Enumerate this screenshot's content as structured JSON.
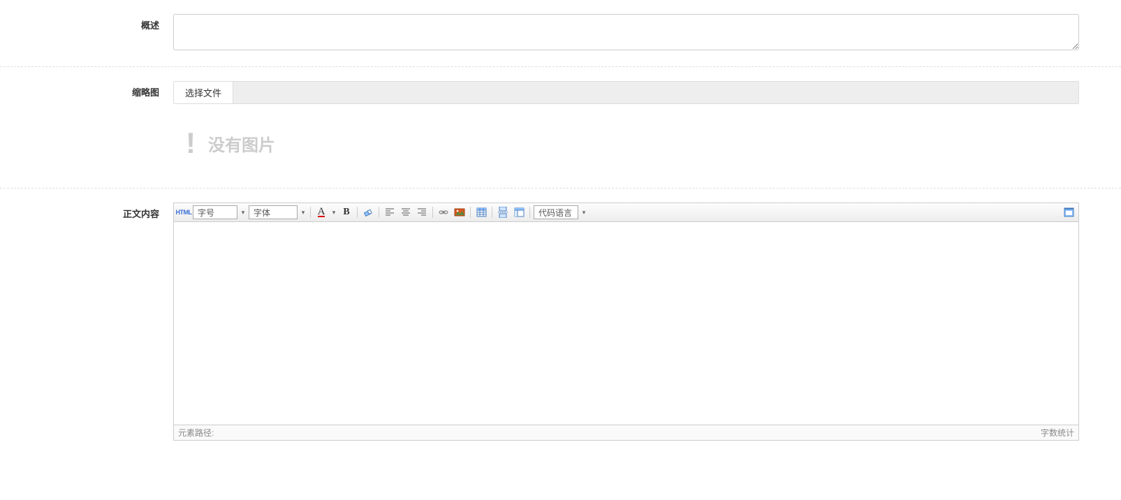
{
  "form": {
    "summary": {
      "label": "概述",
      "value": ""
    },
    "thumbnail": {
      "label": "缩略图",
      "fileButton": "选择文件",
      "noImageText": "没有图片"
    },
    "content": {
      "label": "正文内容"
    }
  },
  "editor": {
    "toolbar": {
      "html": "HTML",
      "fontSize": "字号",
      "fontFamily": "字体",
      "codeLang": "代码语言"
    },
    "status": {
      "path": "元素路径:",
      "wordCount": "字数统计"
    }
  }
}
